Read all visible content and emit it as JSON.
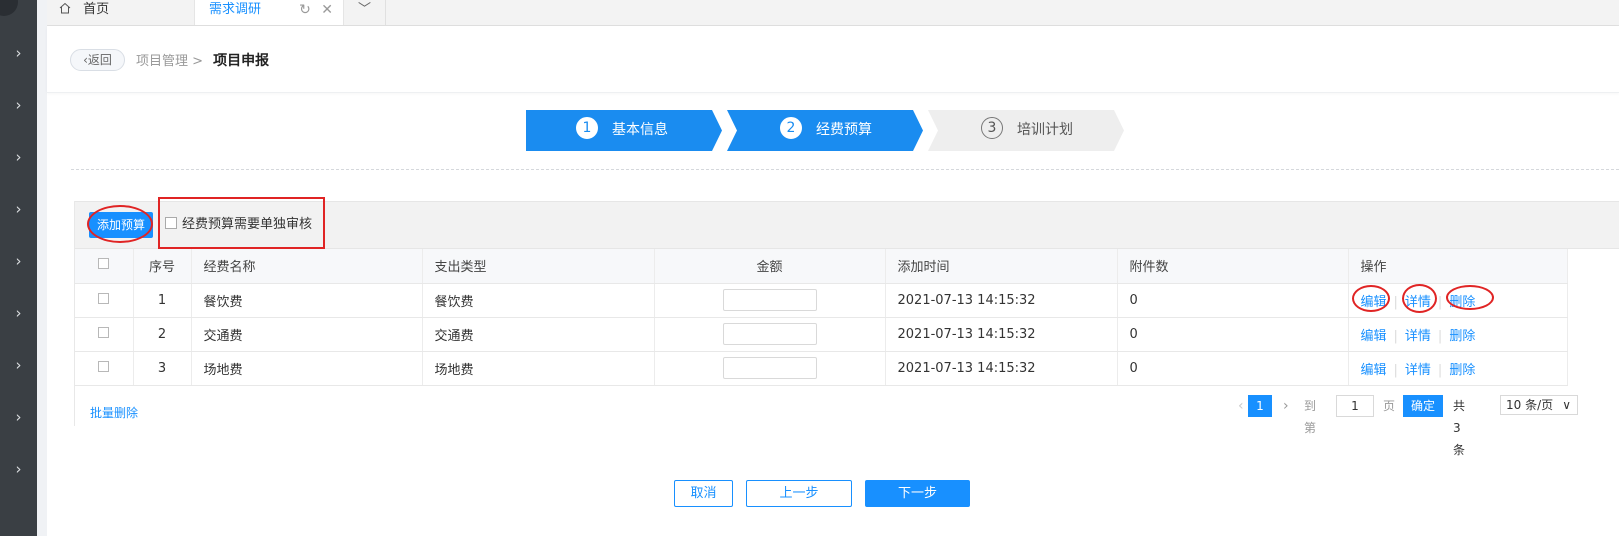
{
  "tabs": {
    "home": "首页",
    "active": "需求调研",
    "refresh_glyph": "↻",
    "close_glyph": "✕",
    "more_glyph": "﹀"
  },
  "header": {
    "back": "返回",
    "crumb_parent": "项目管理 >",
    "crumb_current": "项目申报"
  },
  "steps": [
    {
      "num": "1",
      "label": "基本信息"
    },
    {
      "num": "2",
      "label": "经费预算"
    },
    {
      "num": "3",
      "label": "培训计划"
    }
  ],
  "toolbar": {
    "add_label": "添加预算",
    "review_label": "经费预算需要单独审核"
  },
  "table": {
    "columns": [
      "序号",
      "经费名称",
      "支出类型",
      "金额",
      "添加时间",
      "附件数",
      "操作"
    ],
    "rows": [
      {
        "idx": "1",
        "name": "餐饮费",
        "type": "餐饮费",
        "amount": "",
        "time": "2021-07-13 14:15:32",
        "files": "0"
      },
      {
        "idx": "2",
        "name": "交通费",
        "type": "交通费",
        "amount": "",
        "time": "2021-07-13 14:15:32",
        "files": "0"
      },
      {
        "idx": "3",
        "name": "场地费",
        "type": "场地费",
        "amount": "",
        "time": "2021-07-13 14:15:32",
        "files": "0"
      }
    ],
    "ops": {
      "edit": "编辑",
      "detail": "详情",
      "delete": "删除"
    },
    "bulk_delete": "批量删除"
  },
  "pagination": {
    "prev": "‹",
    "current": "1",
    "next": "›",
    "goto": "到第",
    "page_input": "1",
    "page_unit": "页",
    "confirm": "确定",
    "total": "共 3 条",
    "page_size": "10 条/页",
    "page_size_arrow": "∨"
  },
  "footer": {
    "cancel": "取消",
    "prev": "上一步",
    "next": "下一步"
  },
  "colors": {
    "primary": "#1890ff",
    "step_active": "#1a8cf0",
    "annotation": "#e02424",
    "sidebar": "#3a3f44"
  }
}
